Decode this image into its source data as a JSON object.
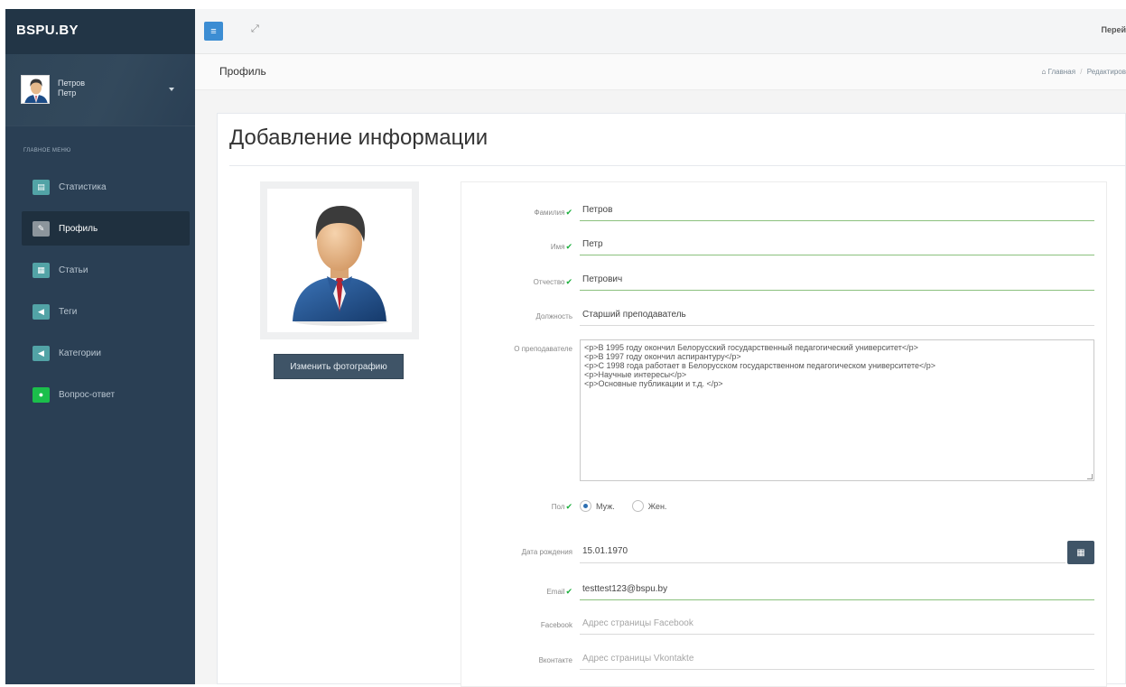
{
  "sidebar": {
    "brand": "BSPU.BY",
    "user": {
      "last_name": "Петров",
      "first_name": "Петр"
    },
    "menu_title": "ГЛАВНОЕ МЕНЮ",
    "items": [
      {
        "label": "Статистика",
        "icon": "table-icon",
        "active": false
      },
      {
        "label": "Профиль",
        "icon": "pencil-icon",
        "active": true
      },
      {
        "label": "Статьи",
        "icon": "newspaper-icon",
        "active": false
      },
      {
        "label": "Теги",
        "icon": "tag-icon",
        "active": false
      },
      {
        "label": "Категории",
        "icon": "tags-icon",
        "active": false
      },
      {
        "label": "Вопрос-ответ",
        "icon": "comment-icon",
        "active": false
      }
    ]
  },
  "topbar": {
    "right_link": "Перей"
  },
  "pagebar": {
    "title": "Профиль",
    "breadcrumb_home": "Главная",
    "breadcrumb_sep": "/",
    "breadcrumb_current": "Редактиров"
  },
  "panel": {
    "title": "Добавление информации",
    "change_photo_label": "Изменить фотографию"
  },
  "form": {
    "surname": {
      "label": "Фамилия",
      "value": "Петров"
    },
    "name": {
      "label": "Имя",
      "value": "Петр"
    },
    "patronymic": {
      "label": "Отчество",
      "value": "Петрович"
    },
    "position": {
      "label": "Должность",
      "value": "Старший преподаватель"
    },
    "about": {
      "label": "О преподавателе",
      "lines": [
        "<p>В 1995 году окончил Белорусский государственный педагогический университет</p>",
        "<p>В 1997 году окончил аспирантуру</p>",
        "<p>С 1998 года работает в Белорусском государственном педагогическом университете</p>",
        "<p>Научные интересы</p>",
        "<p>Основные публикации и т.д. </p>"
      ]
    },
    "gender": {
      "label": "Пол",
      "male": "Муж.",
      "female": "Жен.",
      "selected": "male"
    },
    "birth_date": {
      "label": "Дата рождения",
      "value": "15.01.1970"
    },
    "email": {
      "label": "Email",
      "value": "testtest123@bspu.by"
    },
    "facebook": {
      "label": "Facebook",
      "placeholder": "Адрес страницы Facebook"
    },
    "vkontakte": {
      "label": "Вконтакте",
      "placeholder": "Адрес страницы Vkontakte"
    }
  },
  "colors": {
    "sidebar": "#2a3f54",
    "accent": "#3c8dd3",
    "valid": "#1aaf3b",
    "button": "#3f5467"
  }
}
